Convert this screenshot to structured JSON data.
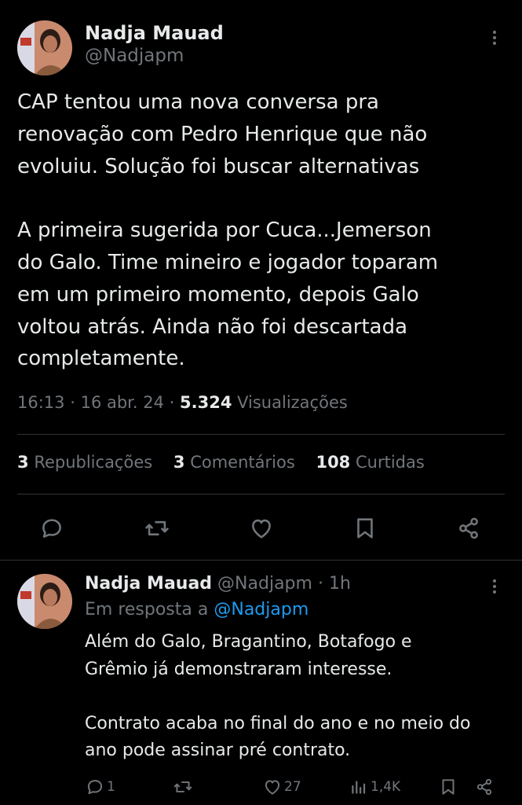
{
  "tweet": {
    "author_name": "Nadja Mauad",
    "author_handle": "@Nadjapm",
    "text": "CAP tentou uma nova conversa pra\nrenovação com Pedro Henrique que não\nevoluiu. Solução foi buscar alternativas\n\nA primeira sugerida por Cuca...Jemerson\ndo Galo. Time mineiro e jogador toparam\nem um primeiro momento, depois Galo\nvoltou atrás. Ainda não foi descartada\ncompletamente.",
    "time": "16:13",
    "date": "16 abr. 24",
    "views_count": "5.324",
    "views_label": "Visualizações",
    "reposts_count": "3",
    "reposts_label": "Republicações",
    "comments_count": "3",
    "comments_label": "Comentários",
    "likes_count": "108",
    "likes_label": "Curtidas"
  },
  "reply": {
    "author_name": "Nadja Mauad",
    "author_handle": "@Nadjapm",
    "age": "1h",
    "in_reply_prefix": "Em resposta a",
    "in_reply_mention": "@Nadjapm",
    "text": "Além do Galo, Bragantino, Botafogo e\nGrêmio já demonstraram interesse.\n\nContrato acaba no final do ano e no meio do\nano pode assinar pré contrato.",
    "replies": "1",
    "likes": "27",
    "views": "1,4K"
  },
  "icons": {
    "reply": "reply-icon",
    "repost": "repost-icon",
    "like": "heart-icon",
    "bookmark": "bookmark-icon",
    "share": "share-icon",
    "views": "views-icon",
    "more": "more-icon"
  },
  "colors": {
    "background": "#000000",
    "text": "#e7e9ea",
    "muted": "#71767b",
    "accent": "#1d9bf0",
    "divider": "#2f3336"
  }
}
